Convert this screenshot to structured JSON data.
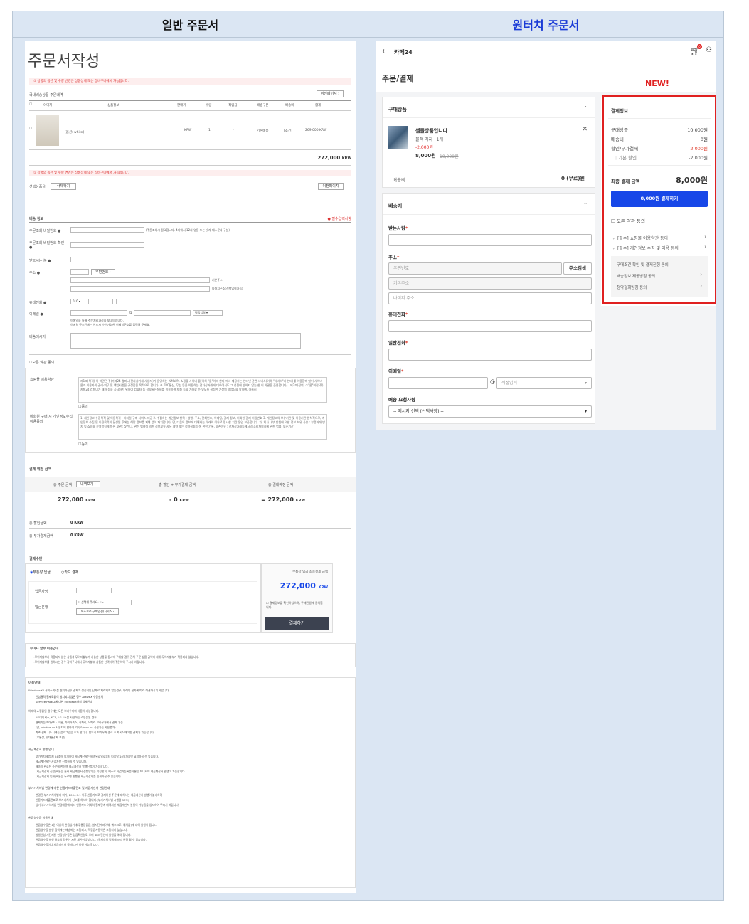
{
  "headers": {
    "left": "일반 주문서",
    "right": "원터치 주문서"
  },
  "left": {
    "title": "주문서작성",
    "notice_top": "① 상품의 옵션 및 수량 변경은 상품상세 또는 장바구니에서 가능합니다.",
    "domestic_label": "국내배송상품 주문내역",
    "prev_page_btn": "이전페이지 ›",
    "columns": [
      "이미지",
      "상품정보",
      "판매가",
      "수량",
      "적립금",
      "배송구분",
      "배송비",
      "합계"
    ],
    "item": {
      "option": "[옵션: white]",
      "price": "KRW",
      "qty": "1",
      "points": "-",
      "ship_type": "기본배송",
      "ship_fee": "[조건]",
      "total": "269,000 KRW"
    },
    "subtotal": "272,000",
    "subtotal_unit": "KRW",
    "notice_mid": "① 상품의 옵션 및 수량 변경은 상품상세 또는 장바구니에서 가능합니다.",
    "selected_label": "선택상품을",
    "delete_btn": "삭제하기",
    "prev_btn": "이전페이지",
    "shipping_title": "배송 정보",
    "required_note": "● 필수입력사항",
    "fields": {
      "order_pw": "주문조회 비밀번호 ●",
      "order_pw_hint": "(주문조회시 필요합니다. 4자에서 12자 영문 또는 숫자 대소문자 구분)",
      "order_pw_confirm": "주문조회 비밀번호 확인 ●",
      "receiver": "받으시는 분 ●",
      "address": "주소 ●",
      "zip_btn": "우편번호 ›",
      "addr_basic": "기본주소",
      "addr_detail": "나머지주소(선택입력가능)",
      "mobile": "휴대전화 ●",
      "mobile_prefix": "010",
      "email": "이메일 ●",
      "email_select": "직접입력",
      "email_note1": "이메일을 통해 주문처리과정을 보내드립니다.",
      "email_note2": "이메일 주소란에는 반드시 수신가능한 이메일주소를 입력해 주세요.",
      "message": "배송메시지"
    },
    "agree_all": "모든 약관 동의",
    "terms_label": "쇼핑몰 이용약관",
    "terms_text": "제1조(목적) 이 약관은 주)카페24 컴퍼니(전자상거래 사업자)가 운영하는 %Mall% 쇼핑몰 사이버 몰(이하 \"몰\"이라 한다)에서 제공하는 인터넷 관련 서비스(이하 \"서비스\"라 한다)를 이용함에 있어 사이버 몰과 이용자의 권리·의무 및 책임사항을 규정함을 목적으로 합니다. ※「PC통신, 무선 등을 이용하는 전자상거래에 대하여서도 그 성질에 반하지 않는 한 이 약관을 준용합니다」 제2조(정의) ①\"몰\"이란 주)카페24 컴퍼니가 재화 등을 공급하기 위하여 컴퓨터 등 정보통신설비를 이용하여 재화 등을 거래할 수 있도록 설정한 가상의 영업장을 말하며, 아울러",
    "terms_agree": "동의",
    "privacy_label": "비회원 구매 시 개인정보수집 이용동의",
    "privacy_text": "1. 개인정보 수집목적 및 이용목적 : 비회원 구매 서비스 제공 2. 수집하는 개인정보 항목 : 성명, 주소, 전화번호, 이메일, 결제 정보, 비회원 결제 비밀번호 3. 개인정보의 보유기간 및 이용기간 원칙적으로, 개인정보 수집 및 이용목적이 달성된 후에는 해당 정보를 지체 없이 파기합니다. 단, 다음의 정보에 대해서는 아래의 이유로 명시한 기간 동안 보존합니다. 가. 회사 내부 방침에 의한 정보 보유 사유 : 부정거래 방지 및 쇼핑몰 운영방침에 따른 보관 : 5년 나. 관련 법령에 의한 정보보유 사유 계약 또는 청약철회 등에 관한 기록, 보존이유 : 전자상거래등에서의 소비자보호에 관한 법률, 보존기간",
    "privacy_agree": "동의",
    "pay_pred_title": "결제 예정 금액",
    "pay_heads": [
      "총 주문 금액",
      "총 할인 + 부가결제 금액",
      "총 결제예정 금액"
    ],
    "detail_btn": "내역보기 ›",
    "pay_vals": [
      "272,000",
      "- 0",
      "= 272,000"
    ],
    "krw": "KRW",
    "discount_label": "총 할인금액",
    "discount_val": "0",
    "discount_unit": "KRW",
    "extra_label": "총 부가결제금액",
    "extra_val": "0",
    "extra_unit": "KRW",
    "paymethod_title": "결제수단",
    "method_bank": "무통장 입금",
    "method_card": "카드 결제",
    "depositor": "입금자명",
    "bank": "입금은행",
    "bank_select": ":: 선택해 주세요. ::",
    "escrow_btn": "에스크로(구매안전)서비스 ›",
    "final_label": "무통장 입금 최종결제 금액",
    "final_amount": "272,000",
    "final_unit": "KRW",
    "confirm_check": "결제정보를 확인하였으며, 구매진행에 동의합니다.",
    "pay_btn": "결제하기",
    "nobankbook_title": "무이자 할부 이용안내",
    "nobankbook_lines": [
      "- 무이자할부가 적용되지 않은 상품과 무이자할부가 가능한 상품을 동시에 구매할 경우 전체 주문 상품 금액에 대해 무이자할부가 적용되지 않습니다.",
      "- 무이자할부를 원하시는 경우 장바구니에서 무이자할부 상품만 선택하여 주문하여 주시기 바랍니다."
    ],
    "usage_title": "이용안내",
    "usage_intro": "WindowsXP 서비스팩2를 설치하신후 결제가 정상적인 단계로 처리되지 않는경우, 아래의 절차에 따라 해결하시기 바랍니다.",
    "usage_lines": [
      "안심클릭 결제모듈이 설치되지 않은 경우 ActiveX 수동설치",
      "Service Pack 2에 대한 Microsoft사의 상세안내"
    ],
    "usage_sub1": "아래의 쇼핑몰일 경우에는 모든 브라우저의 사용이 가능합니다.",
    "usage_sub1_lines": [
      "KG이니시스, KCP, LG U+를 사용하는 쇼핑몰일 경우",
      "결제가능브라우저 : 크롬, 파이어폭스, 사파리, 오페라 브라우저에서 결제 가능",
      "(단, window os 사용자에 한하며 리눅스/mac os 사용자는 사용불가)",
      "최초 결제 시도시에는 플러그인을 추가 설치 후 반드시 브라우저 종료 후 재시작해야만 결제가 가능합니다.",
      "(무통장, 휴대폰결제 포함)"
    ],
    "tax_title": "세금계산서 발행 안내",
    "tax_lines": [
      "부가가치세법 제 54조에 의거하여 세금계산서는 배송완료일로부터 다음달 10일까지만 요청하실 수 있습니다.",
      "세금계산서는 사업자만 신청하실 수 있습니다.",
      "배송이 완료된 주문에 한하여 세금계산서 발행신청이 가능합니다.",
      "[세금계산서 신청]버튼을 눌러 세금계산서 신청양식을 작성한 후 팩스로 사업자등록증사본을 보내셔야 세금계산서 발생이 가능합니다.",
      "[세금계산서 인쇄]버튼을 누르면 발행된 세금계산서를 인쇄하실 수 있습니다."
    ],
    "vat_title": "부가가치세법 변경에 따른 신용카드매출전표 및 세금계산서 변경안내",
    "vat_lines": [
      "변경된 부가가치세법에 의거, 2004.7.1 이후 신용카드로 결제하신 주문에 대해서는 세금계산서 발행이 불가하며",
      "신용카드매출전표로 부가가치세 신고를 하셔야 합니다.(부가가치세법 시행령 57조)",
      "상기 부가가치세법 변경내용에 따라 신용카드 이외의 결제건에 대해서만 세금계산서 발행이 가능함을 양지하여 주시기 바랍니다."
    ],
    "cash_title": "현금영수증 이용안내",
    "cash_lines": [
      "현금영수증은 1원 이상의 현금성거래(무통장입금, 실시간계좌이체, 에스크로, 예치금)에 대해 발행이 됩니다.",
      "현금영수증 발행 금액에는 배송비는 포함되고, 적립금사용액은 포함되지 않습니다.",
      "발행신청 기간제한 현금영수증은 입금확인일로 부터 48시간안에 발행을 해야 합니다.",
      "현금영수증 발행 취소의 경우는 시간 제한이 없습니다. (국세청의 정책에 따라 변경 될 수 있습니다.)",
      "현금영수증이나 세금계산서 중 하나만 발행 가능 합니다."
    ]
  },
  "right": {
    "back": "←",
    "store": "카페24",
    "cart_badge": "0",
    "page_title": "주문/결제",
    "new_badge": "NEW!",
    "products_title": "구매상품",
    "product": {
      "name": "샘플상품입니다",
      "option": "블랙 라지",
      "qty": "1개",
      "discount": "-2,000원",
      "price": "8,000원",
      "orig_price": "10,000원"
    },
    "ship_fee_label": "배송비",
    "ship_fee_val": "0 (무료)원",
    "dest_title": "배송지",
    "receiver": "받는사람",
    "address": "주소",
    "zip_ph": "우편번호",
    "zip_btn": "주소검색",
    "addr_ph": "기본주소",
    "addr_detail_ph": "나머지 주소",
    "mobile": "휴대전화",
    "phone": "일반전화",
    "email": "이메일",
    "email_at": "@",
    "email_select": "직접입력",
    "request": "배송 요청사항",
    "request_select": "-- 메시지 선택 (선택사항) --",
    "pay_title": "결제정보",
    "pay_rows": [
      {
        "label": "구매상품",
        "val": "10,000원"
      },
      {
        "label": "배송비",
        "val": "0원"
      },
      {
        "label": "할인/부가결제",
        "val": "-2,000원"
      },
      {
        "label": "기본 할인",
        "val": "-2,000원"
      }
    ],
    "final_label": "최종 결제 금액",
    "final_val": "8,000원",
    "pay_btn": "8,000원 결제하기",
    "agree_all": "모든 약관 동의",
    "agree1": "[필수] 쇼핑몰 이용약관 동의",
    "agree2": "[필수] 개인정보 수집 및 이용 동의",
    "agree_box": [
      "구매조건 확인 및 결제진행 동의",
      "배송정보 제공방침 동의",
      "청약철회방침 동의"
    ],
    "accent": "#1747e8",
    "red": "#e02020"
  }
}
